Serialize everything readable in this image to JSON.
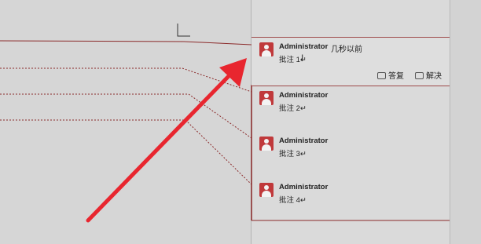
{
  "comments": [
    {
      "author": "Administrator",
      "time": "几秒以前",
      "text": "批注 1↵",
      "active": true
    },
    {
      "author": "Administrator",
      "text": "批注 2↵"
    },
    {
      "author": "Administrator",
      "text": "批注 3↵"
    },
    {
      "author": "Administrator",
      "text": "批注 4↵"
    }
  ],
  "actions": {
    "reply_label": "答复",
    "resolve_label": "解决"
  },
  "icons": {
    "avatar": "user-avatar-icon",
    "reply": "comment-reply-icon",
    "resolve": "comment-resolve-icon",
    "arrow": "red-arrow-annotation"
  },
  "colors": {
    "markup_line": "#8b2a2a",
    "active_border": "#9e4a4a",
    "avatar": "#c0393b",
    "arrow": "#e8262f"
  }
}
